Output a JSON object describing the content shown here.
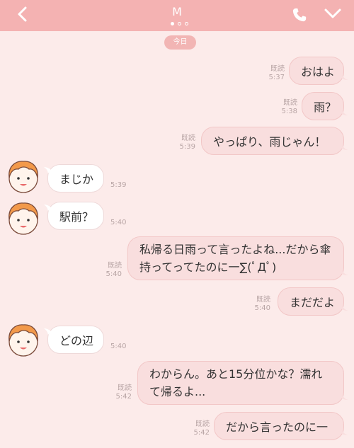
{
  "header": {
    "title": "M",
    "back_icon": "chevron-left-icon",
    "call_icon": "phone-icon",
    "menu_icon": "chevron-down-icon",
    "page_dots": 3,
    "active_dot": 1
  },
  "date_badge": "今日",
  "colors": {
    "header": "#f4b2b2",
    "background": "#fcebea",
    "outgoing_bubble": "#f9dede",
    "incoming_bubble": "#ffffff"
  },
  "messages": [
    {
      "text": "おはよ",
      "read": "既読",
      "time": "5:37"
    },
    {
      "text": "雨？",
      "read": "既読",
      "time": "5:38"
    },
    {
      "text": "やっぱり、雨じゃん！",
      "read": "既読",
      "time": "5:39"
    },
    {
      "text": "まじか",
      "time": "5:39"
    },
    {
      "text": "駅前？",
      "time": "5:40"
    },
    {
      "text": "私帰る日雨って言ったよね...だから傘持ってってたのに一∑(ﾟДﾟ)",
      "read": "既読",
      "time": "5:40"
    },
    {
      "text": "まだだよ",
      "read": "既読",
      "time": "5:40"
    },
    {
      "text": "どの辺",
      "time": "5:40"
    },
    {
      "text": "わからん。あと15分位かな？濡れて帰るよ...",
      "read": "既読",
      "time": "5:42"
    },
    {
      "text": "だから言ったのに一",
      "read": "既読",
      "time": "5:42"
    }
  ]
}
